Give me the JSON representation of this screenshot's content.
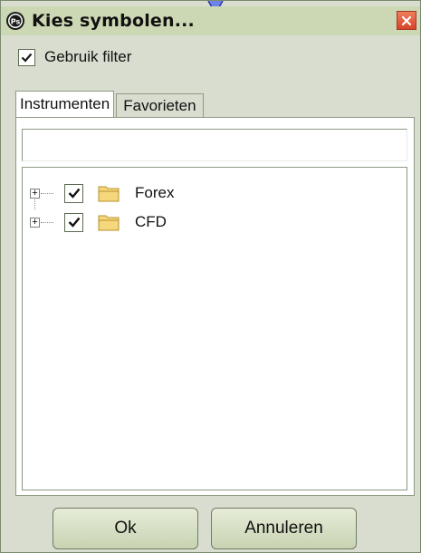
{
  "window": {
    "title": "Kies symbolen...",
    "icon": "ps-app-icon",
    "close_icon": "close-icon"
  },
  "filter": {
    "checked": true,
    "label": "Gebruik filter"
  },
  "tabs": [
    {
      "label": "Instrumenten",
      "active": true
    },
    {
      "label": "Favorieten",
      "active": false
    }
  ],
  "search": {
    "value": "",
    "placeholder": ""
  },
  "tree": {
    "items": [
      {
        "label": "Forex",
        "checked": true,
        "expander": "plus",
        "icon": "folder-icon"
      },
      {
        "label": "CFD",
        "checked": true,
        "expander": "plus",
        "icon": "folder-icon"
      }
    ]
  },
  "buttons": {
    "ok_label": "Ok",
    "cancel_label": "Annuleren"
  },
  "colors": {
    "window_bg": "#d8ddd0",
    "title_bg": "#ccd8b4",
    "close_red": "#d8432a",
    "folder_yellow": "#e8c35a",
    "cursor_blue": "#3a4fd0"
  }
}
